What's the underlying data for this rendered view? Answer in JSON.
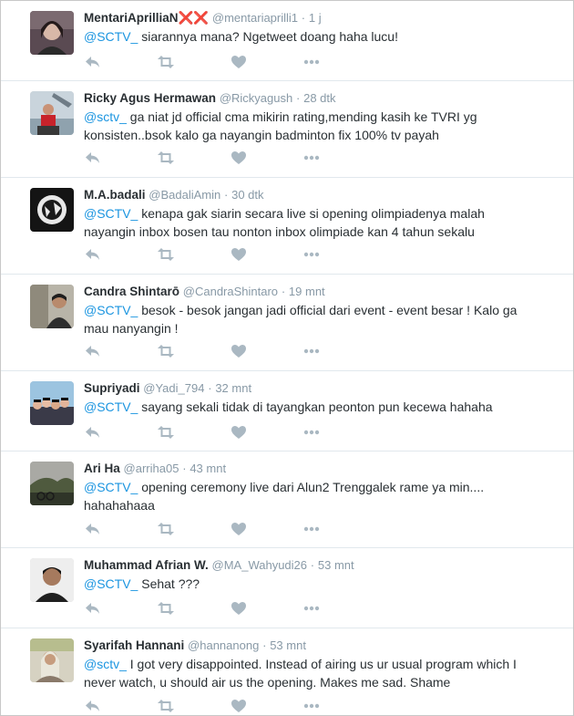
{
  "tweets": [
    {
      "name": "MentariAprilliaN❌❌",
      "handle": "@mentariaprilli1",
      "time": "1 j",
      "mention": "@SCTV_",
      "text": " siarannya mana? Ngetweet doang haha lucu!"
    },
    {
      "name": "Ricky Agus Hermawan",
      "handle": "@Rickyagush",
      "time": "28 dtk",
      "mention": "@sctv_",
      "text": " ga niat jd official cma mikirin rating,mending kasih ke TVRI yg konsisten..bsok kalo ga nayangin badminton fix 100% tv payah"
    },
    {
      "name": "M.A.badali",
      "handle": "@BadaliAmin",
      "time": "30 dtk",
      "mention": "@SCTV_",
      "text": " kenapa gak siarin secara live si opening olimpiadenya malah nayangin inbox bosen tau nonton inbox olimpiade kan 4 tahun sekalu"
    },
    {
      "name": "Candra Shintarō",
      "handle": "@CandraShintaro",
      "time": "19 mnt",
      "mention": "@SCTV_",
      "text": " besok - besok jangan jadi official dari event - event besar ! Kalo ga mau nanyangin !"
    },
    {
      "name": "Supriyadi",
      "handle": "@Yadi_794",
      "time": "32 mnt",
      "mention": "@SCTV_",
      "text": " sayang sekali tidak di tayangkan peonton pun kecewa hahaha"
    },
    {
      "name": "Ari Ha",
      "handle": "@arriha05",
      "time": "43 mnt",
      "mention": "@SCTV_",
      "text": " opening ceremony live dari Alun2 Trenggalek rame ya min.... hahahahaaa"
    },
    {
      "name": "Muhammad Afrian W.",
      "handle": "@MA_Wahyudi26",
      "time": "53 mnt",
      "mention": "@SCTV_",
      "text": " Sehat ???"
    },
    {
      "name": "Syarifah Hannani",
      "handle": "@hannanong",
      "time": "53 mnt",
      "mention": "@sctv_",
      "text": " I got very disappointed. Instead of airing us ur usual program which I never watch, u should air us the opening. Makes me sad. Shame"
    }
  ],
  "icons": {
    "reply": "reply-icon",
    "retweet": "retweet-icon",
    "like": "heart-icon",
    "more": "more-icon"
  },
  "colors": {
    "mention": "#1b95e0",
    "meta": "#8899a6",
    "action": "#aab8c2"
  }
}
